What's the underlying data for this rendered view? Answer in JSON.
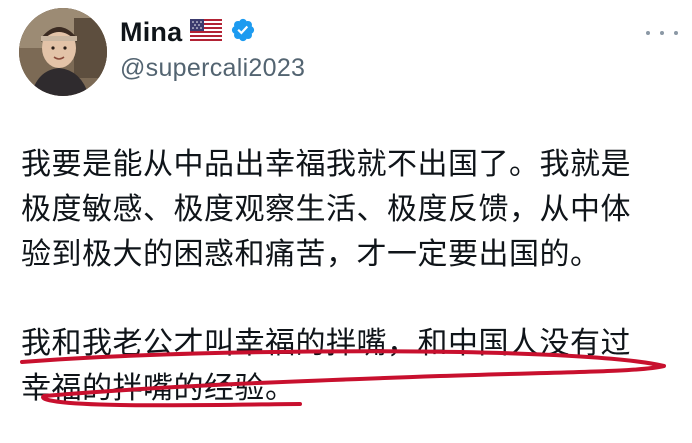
{
  "author": {
    "name": "Mina",
    "flag_emoji": "🇺🇸",
    "handle": "@supercali2023",
    "verified": true
  },
  "icons": {
    "avatar": "profile-photo",
    "flag": "us-flag-icon",
    "verified": "verified-badge-icon",
    "more": "more-options-icon"
  },
  "colors": {
    "text": "#0f1419",
    "handle": "#536471",
    "verified_blue": "#1d9bf0",
    "underline_red": "#c8102e"
  },
  "tweet": {
    "paragraph_1": {
      "lines": [
        "我要是能从中品出幸福我就不出国了。我就是",
        "极度敏感、极度观察生活、极度反馈，从中体",
        "验到极大的困惑和痛苦，才一定要出国的。"
      ]
    },
    "paragraph_2": {
      "lines": [
        "我和我老公才叫幸福的拌嘴，和中国人没有过",
        "幸福的拌嘴的经验。"
      ]
    }
  }
}
